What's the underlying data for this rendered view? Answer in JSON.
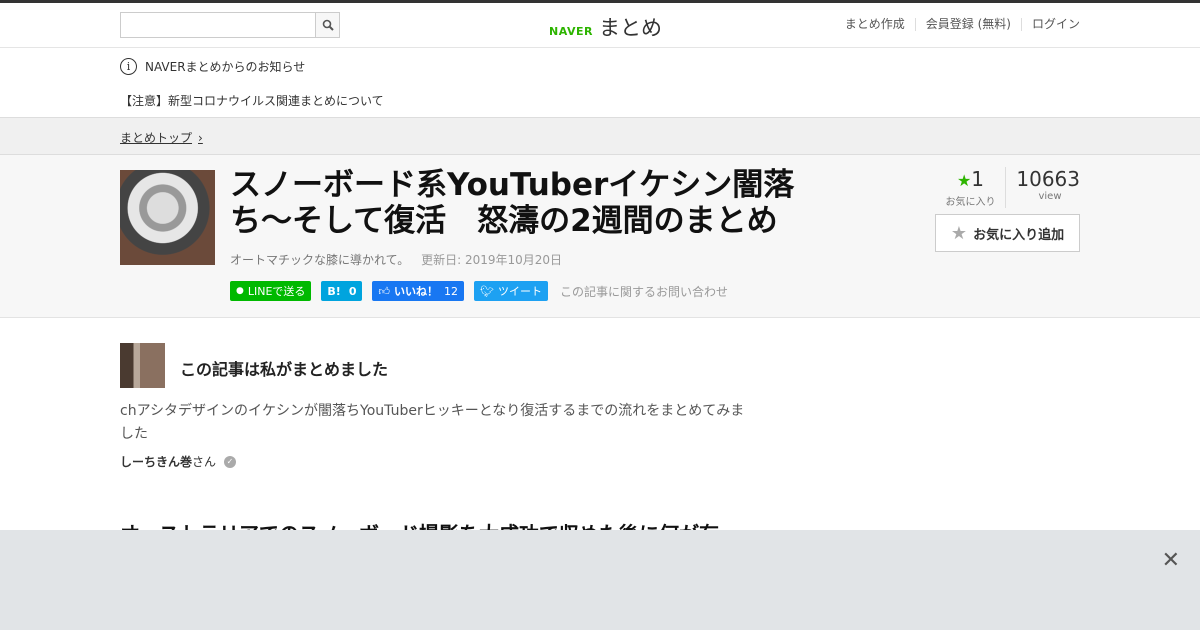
{
  "header": {
    "search_placeholder": "",
    "logo_naver": "NAVER",
    "logo_matome": "まとめ",
    "nav": [
      "まとめ作成",
      "会員登録 (無料)",
      "ログイン"
    ]
  },
  "notice": {
    "heading": "NAVERまとめからのお知らせ",
    "item": "【注意】新型コロナウイルス関連まとめについて"
  },
  "breadcrumb": {
    "top": "まとめトップ"
  },
  "article": {
    "title": "スノーボード系YouTuberイケシン闇落ち〜そして復活　怒濤の2週間のまとめ",
    "subtitle": "オートマチックな膝に導かれて。",
    "updated": "更新日: 2019年10月20日",
    "share": {
      "line": "LINEで送る",
      "hatena_count": "0",
      "like_label": "いいね！",
      "like_count": "12",
      "tweet": "ツイート"
    },
    "inquiry": "この記事に関するお問い合わせ",
    "favorites": "1",
    "favorites_label": "お気に入り",
    "views": "10663",
    "views_label": "view",
    "fav_button": "お気に入り追加"
  },
  "author": {
    "heading": "この記事は私がまとめました",
    "description": "chアシタデザインのイケシンが闇落ちYouTuberヒッキーとなり復活するまでの流れをまとめてみました",
    "name": "しーちきん巻",
    "name_suffix": "さん"
  },
  "section": {
    "title": "オーストラリアでのスノーボード撮影を大成功で収めた後に何が有っ"
  },
  "colors": {
    "accent_green": "#2db400",
    "line_green": "#00b900",
    "facebook_blue": "#1877f2",
    "twitter_blue": "#1da1f2",
    "hatena_blue": "#00a4de"
  }
}
